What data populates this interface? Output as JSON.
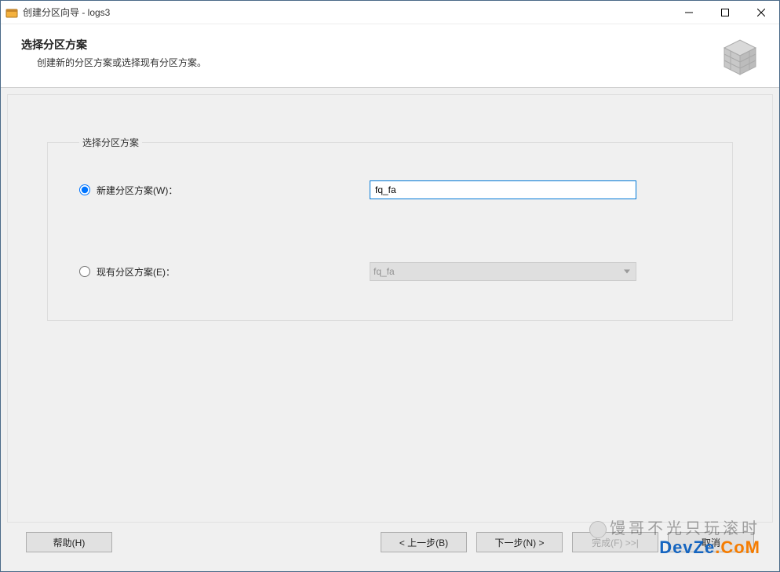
{
  "window": {
    "title": "创建分区向导 - logs3"
  },
  "header": {
    "title": "选择分区方案",
    "subtitle": "创建新的分区方案或选择现有分区方案。"
  },
  "group": {
    "legend": "选择分区方案",
    "new_scheme": {
      "label": "新建分区方案(W)：",
      "value": "fq_fa",
      "checked": true
    },
    "existing_scheme": {
      "label": "现有分区方案(E)：",
      "value": "fq_fa",
      "checked": false
    }
  },
  "buttons": {
    "help": "帮助(H)",
    "back": "< 上一步(B)",
    "next": "下一步(N) >",
    "finish": "完成(F) >>|",
    "cancel": "取消"
  },
  "watermark": {
    "line1": "馒哥不光只玩滚时",
    "brand_a": "DevZe",
    "brand_b": ".CoM"
  }
}
